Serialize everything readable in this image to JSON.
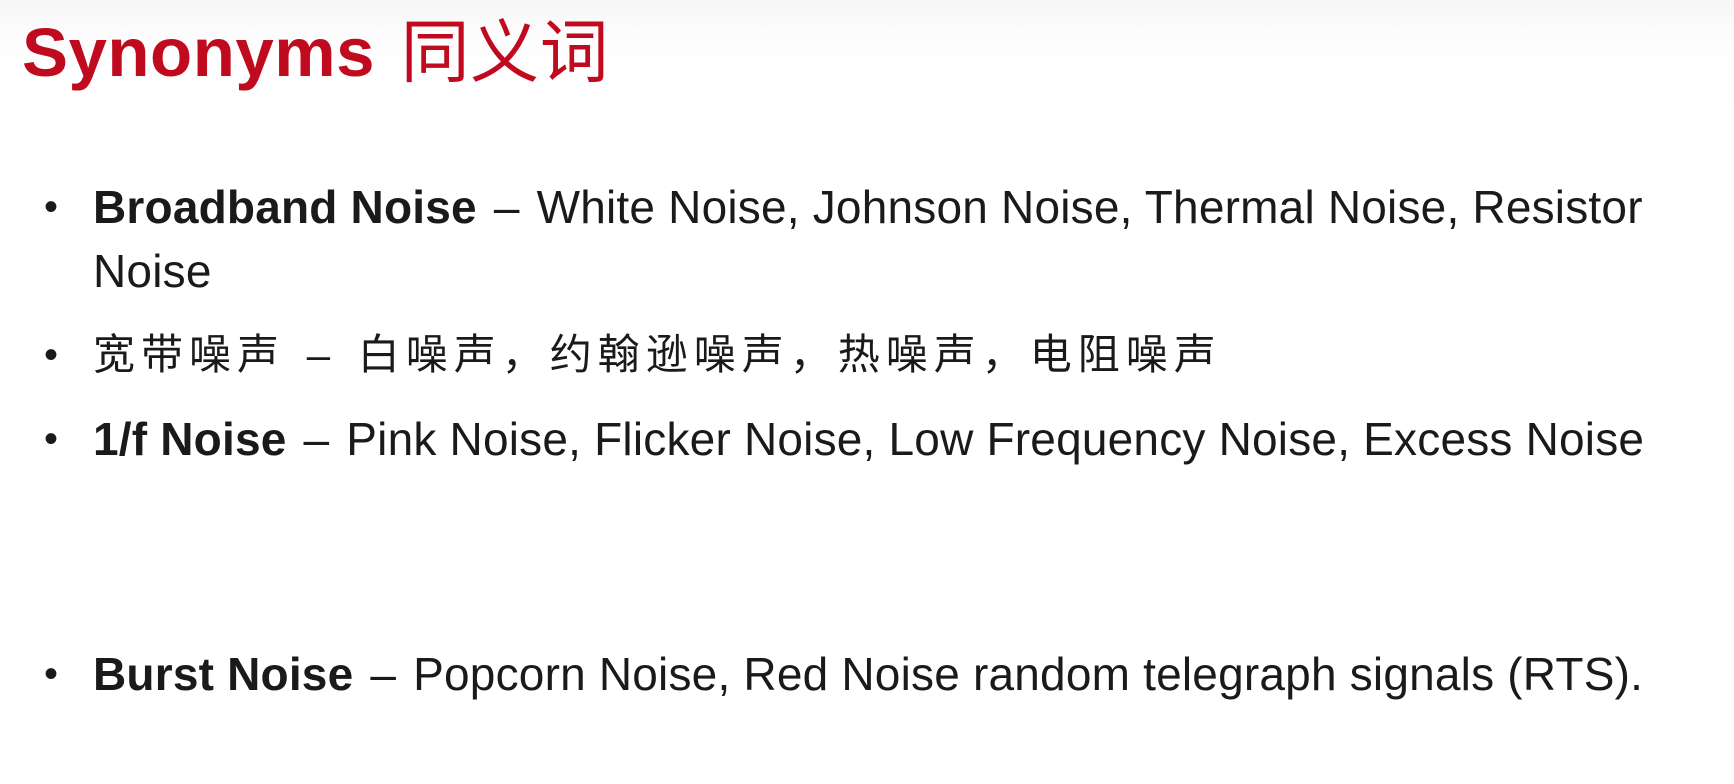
{
  "title": {
    "en": "Synonyms",
    "zh": "同义词"
  },
  "bullets": [
    {
      "term": "Broadband Noise",
      "separator": "–",
      "synonyms": "White Noise, Johnson Noise, Thermal Noise, Resistor Noise"
    },
    {
      "term": "宽带噪声",
      "separator": "–",
      "synonyms": "白噪声，约翰逊噪声，热噪声，电阻噪声"
    },
    {
      "term": "1/f Noise",
      "separator": "–",
      "synonyms": "Pink Noise, Flicker Noise, Low Frequency Noise, Excess Noise"
    },
    {
      "term": "Burst Noise",
      "separator": "–",
      "synonyms": "Popcorn Noise, Red Noise random telegraph signals (RTS)."
    }
  ],
  "bullet_glyph": "•",
  "colors": {
    "title": "#c00a1e",
    "text": "#1a1a1a",
    "background": "#ffffff"
  }
}
